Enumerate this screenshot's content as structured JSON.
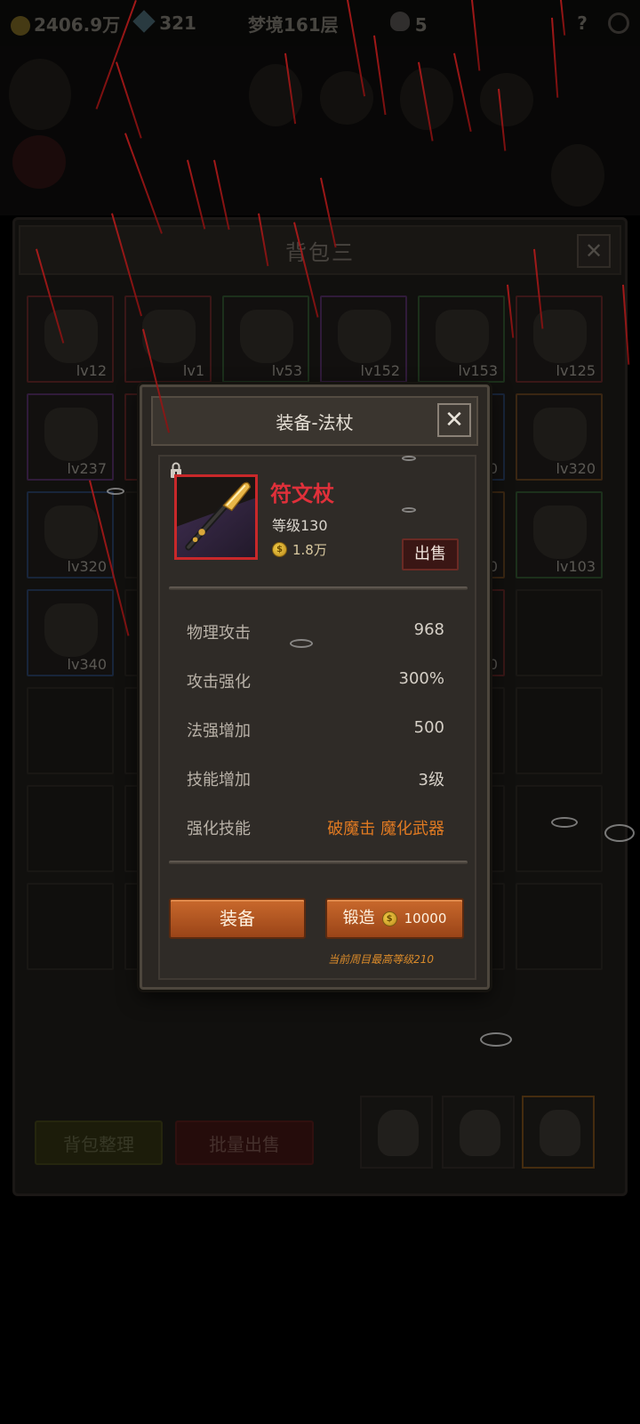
{
  "topbar": {
    "gold": "2406.9万",
    "gems": "321",
    "stage": "梦境161层",
    "kills": "5",
    "help": "?"
  },
  "bag": {
    "title": "背包三",
    "close": "✕",
    "slots": [
      {
        "lv": "lv12",
        "rarity": "red"
      },
      {
        "lv": "lv1",
        "rarity": "red"
      },
      {
        "lv": "lv53",
        "rarity": "green"
      },
      {
        "lv": "lv152",
        "rarity": "purple"
      },
      {
        "lv": "lv153",
        "rarity": "green"
      },
      {
        "lv": "lv125",
        "rarity": "red"
      },
      {
        "lv": "lv237",
        "rarity": "purple"
      },
      {
        "lv": "",
        "rarity": "red"
      },
      {
        "lv": "",
        "rarity": ""
      },
      {
        "lv": "",
        "rarity": ""
      },
      {
        "lv": "0",
        "rarity": "blue"
      },
      {
        "lv": "lv320",
        "rarity": "orange"
      },
      {
        "lv": "lv320",
        "rarity": "blue"
      },
      {
        "lv": "",
        "rarity": ""
      },
      {
        "lv": "",
        "rarity": ""
      },
      {
        "lv": "",
        "rarity": ""
      },
      {
        "lv": "0",
        "rarity": "orange"
      },
      {
        "lv": "lv103",
        "rarity": "green"
      },
      {
        "lv": "lv340",
        "rarity": "blue"
      },
      {
        "lv": "",
        "rarity": ""
      },
      {
        "lv": "",
        "rarity": ""
      },
      {
        "lv": "",
        "rarity": ""
      },
      {
        "lv": "0",
        "rarity": "red"
      },
      {
        "lv": "",
        "rarity": ""
      }
    ],
    "sort_label": "背包整理",
    "bulk_sell_label": "批量出售"
  },
  "dialog": {
    "title": "装备-法杖",
    "close": "✕",
    "item": {
      "name": "符文杖",
      "level": "等级130",
      "price": "1.8万",
      "rarity_color": "#c8282a"
    },
    "sell_label": "出售",
    "stats": [
      {
        "label": "物理攻击",
        "value": "968"
      },
      {
        "label": "攻击强化",
        "value": "300%"
      },
      {
        "label": "法强增加",
        "value": "500"
      },
      {
        "label": "技能增加",
        "value": "3级"
      },
      {
        "label": "强化技能",
        "value": "破魔击 魔化武器"
      }
    ],
    "equip_label": "装备",
    "forge_label": "锻造",
    "forge_cost": "10000",
    "forge_note": "当前周目最高等级210"
  },
  "colors": {
    "accent_orange": "#c9692c",
    "item_name_red": "#e0303a",
    "skill_orange": "#e07a22"
  }
}
